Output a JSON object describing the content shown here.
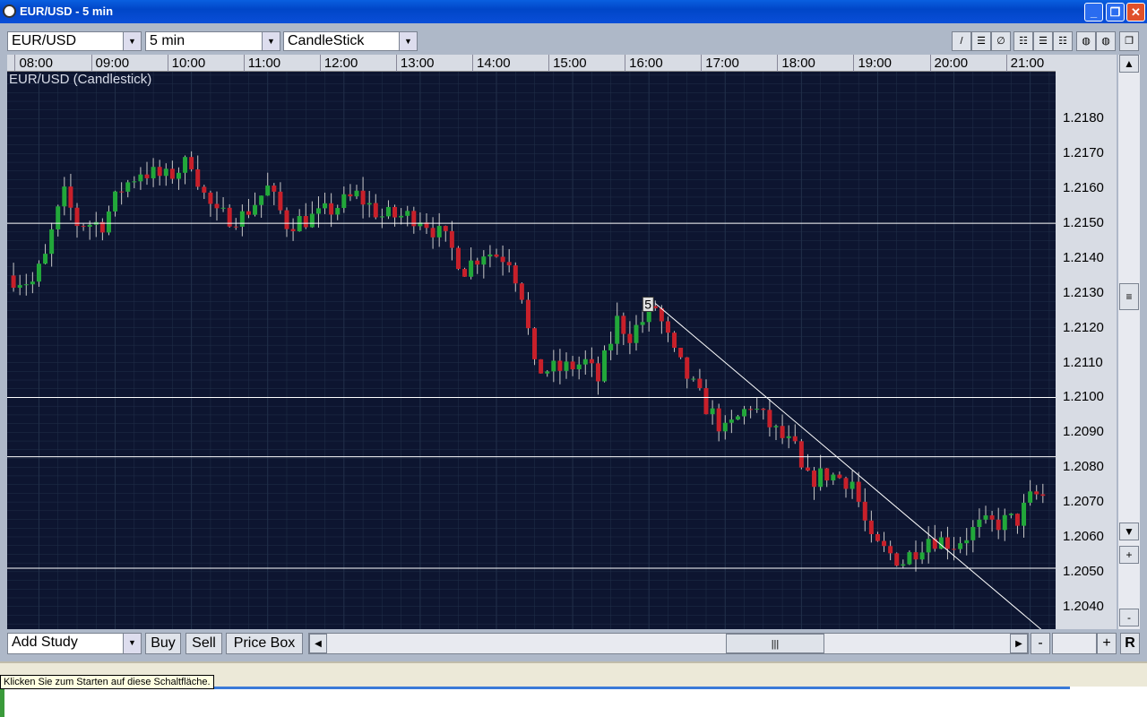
{
  "window": {
    "title": "EUR/USD - 5 min",
    "minimize": "_",
    "restore": "❐",
    "close": "✕"
  },
  "toolbar": {
    "symbol": "EUR/USD",
    "interval": "5 min",
    "chart_type": "CandleStick",
    "tools": [
      {
        "name": "line-tool",
        "glyph": "/"
      },
      {
        "name": "hlines-tool",
        "glyph": "☰"
      },
      {
        "name": "circle-tool",
        "glyph": "∅"
      },
      {
        "name": "grid1-tool",
        "glyph": "☷"
      },
      {
        "name": "grid2-tool",
        "glyph": "☰"
      },
      {
        "name": "grid3-tool",
        "glyph": "☷"
      },
      {
        "name": "color1-tool",
        "glyph": "◍"
      },
      {
        "name": "color2-tool",
        "glyph": "◍"
      },
      {
        "name": "detach-tool",
        "glyph": "❐"
      }
    ]
  },
  "chart_data": {
    "type": "candlestick",
    "title": "EUR/USD (Candlestick)",
    "x_ticks": [
      "08:00",
      "09:00",
      "10:00",
      "11:00",
      "12:00",
      "13:00",
      "14:00",
      "15:00",
      "16:00",
      "17:00",
      "18:00",
      "19:00",
      "20:00",
      "21:00"
    ],
    "y_ticks": [
      "1.2180",
      "1.2170",
      "1.2160",
      "1.2150",
      "1.2140",
      "1.2130",
      "1.2120",
      "1.2110",
      "1.2100",
      "1.2090",
      "1.2080",
      "1.2070",
      "1.2060",
      "1.2050",
      "1.2040"
    ],
    "ylim": [
      1.20335,
      1.21935
    ],
    "x_range_minutes": [
      455,
      1280
    ],
    "price_path": [
      [
        455,
        1.2135
      ],
      [
        475,
        1.2133
      ],
      [
        485,
        1.214
      ],
      [
        492,
        1.215
      ],
      [
        500,
        1.2158
      ],
      [
        510,
        1.215
      ],
      [
        530,
        1.215
      ],
      [
        545,
        1.216
      ],
      [
        560,
        1.2165
      ],
      [
        580,
        1.2163
      ],
      [
        600,
        1.2168
      ],
      [
        610,
        1.2158
      ],
      [
        620,
        1.2152
      ],
      [
        640,
        1.2152
      ],
      [
        660,
        1.216
      ],
      [
        675,
        1.215
      ],
      [
        700,
        1.2152
      ],
      [
        730,
        1.2158
      ],
      [
        750,
        1.2152
      ],
      [
        780,
        1.2152
      ],
      [
        800,
        1.2145
      ],
      [
        815,
        1.2137
      ],
      [
        830,
        1.2142
      ],
      [
        850,
        1.214
      ],
      [
        860,
        1.213
      ],
      [
        870,
        1.2108
      ],
      [
        890,
        1.2108
      ],
      [
        910,
        1.211
      ],
      [
        920,
        1.2105
      ],
      [
        935,
        1.2122
      ],
      [
        945,
        1.2118
      ],
      [
        965,
        1.2126
      ],
      [
        980,
        1.2112
      ],
      [
        1000,
        1.21
      ],
      [
        1020,
        1.209
      ],
      [
        1040,
        1.2098
      ],
      [
        1060,
        1.209
      ],
      [
        1075,
        1.2085
      ],
      [
        1082,
        1.2076
      ],
      [
        1100,
        1.2078
      ],
      [
        1120,
        1.2076
      ],
      [
        1135,
        1.2058
      ],
      [
        1160,
        1.2053
      ],
      [
        1180,
        1.206
      ],
      [
        1200,
        1.2058
      ],
      [
        1220,
        1.2063
      ],
      [
        1250,
        1.2065
      ],
      [
        1262,
        1.2072
      ],
      [
        1280,
        1.2071
      ]
    ],
    "horizontal_lines": [
      1.215,
      1.21,
      1.2083,
      1.2051
    ],
    "trendline": {
      "start": [
        965,
        1.2127
      ],
      "end": [
        1270,
        1.2033
      ]
    },
    "annotation_label": "5",
    "up_color": "#22a83a",
    "down_color": "#c8202a",
    "background": "#0d1530",
    "grid_color": "#22304a"
  },
  "bottom_bar": {
    "add_study": "Add Study",
    "buy": "Buy",
    "sell": "Sell",
    "price_box": "Price Box",
    "zoom_out": "-",
    "zoom_in": "+",
    "reset": "R"
  },
  "tooltip": "Klicken Sie zum Starten auf diese Schaltfläche."
}
